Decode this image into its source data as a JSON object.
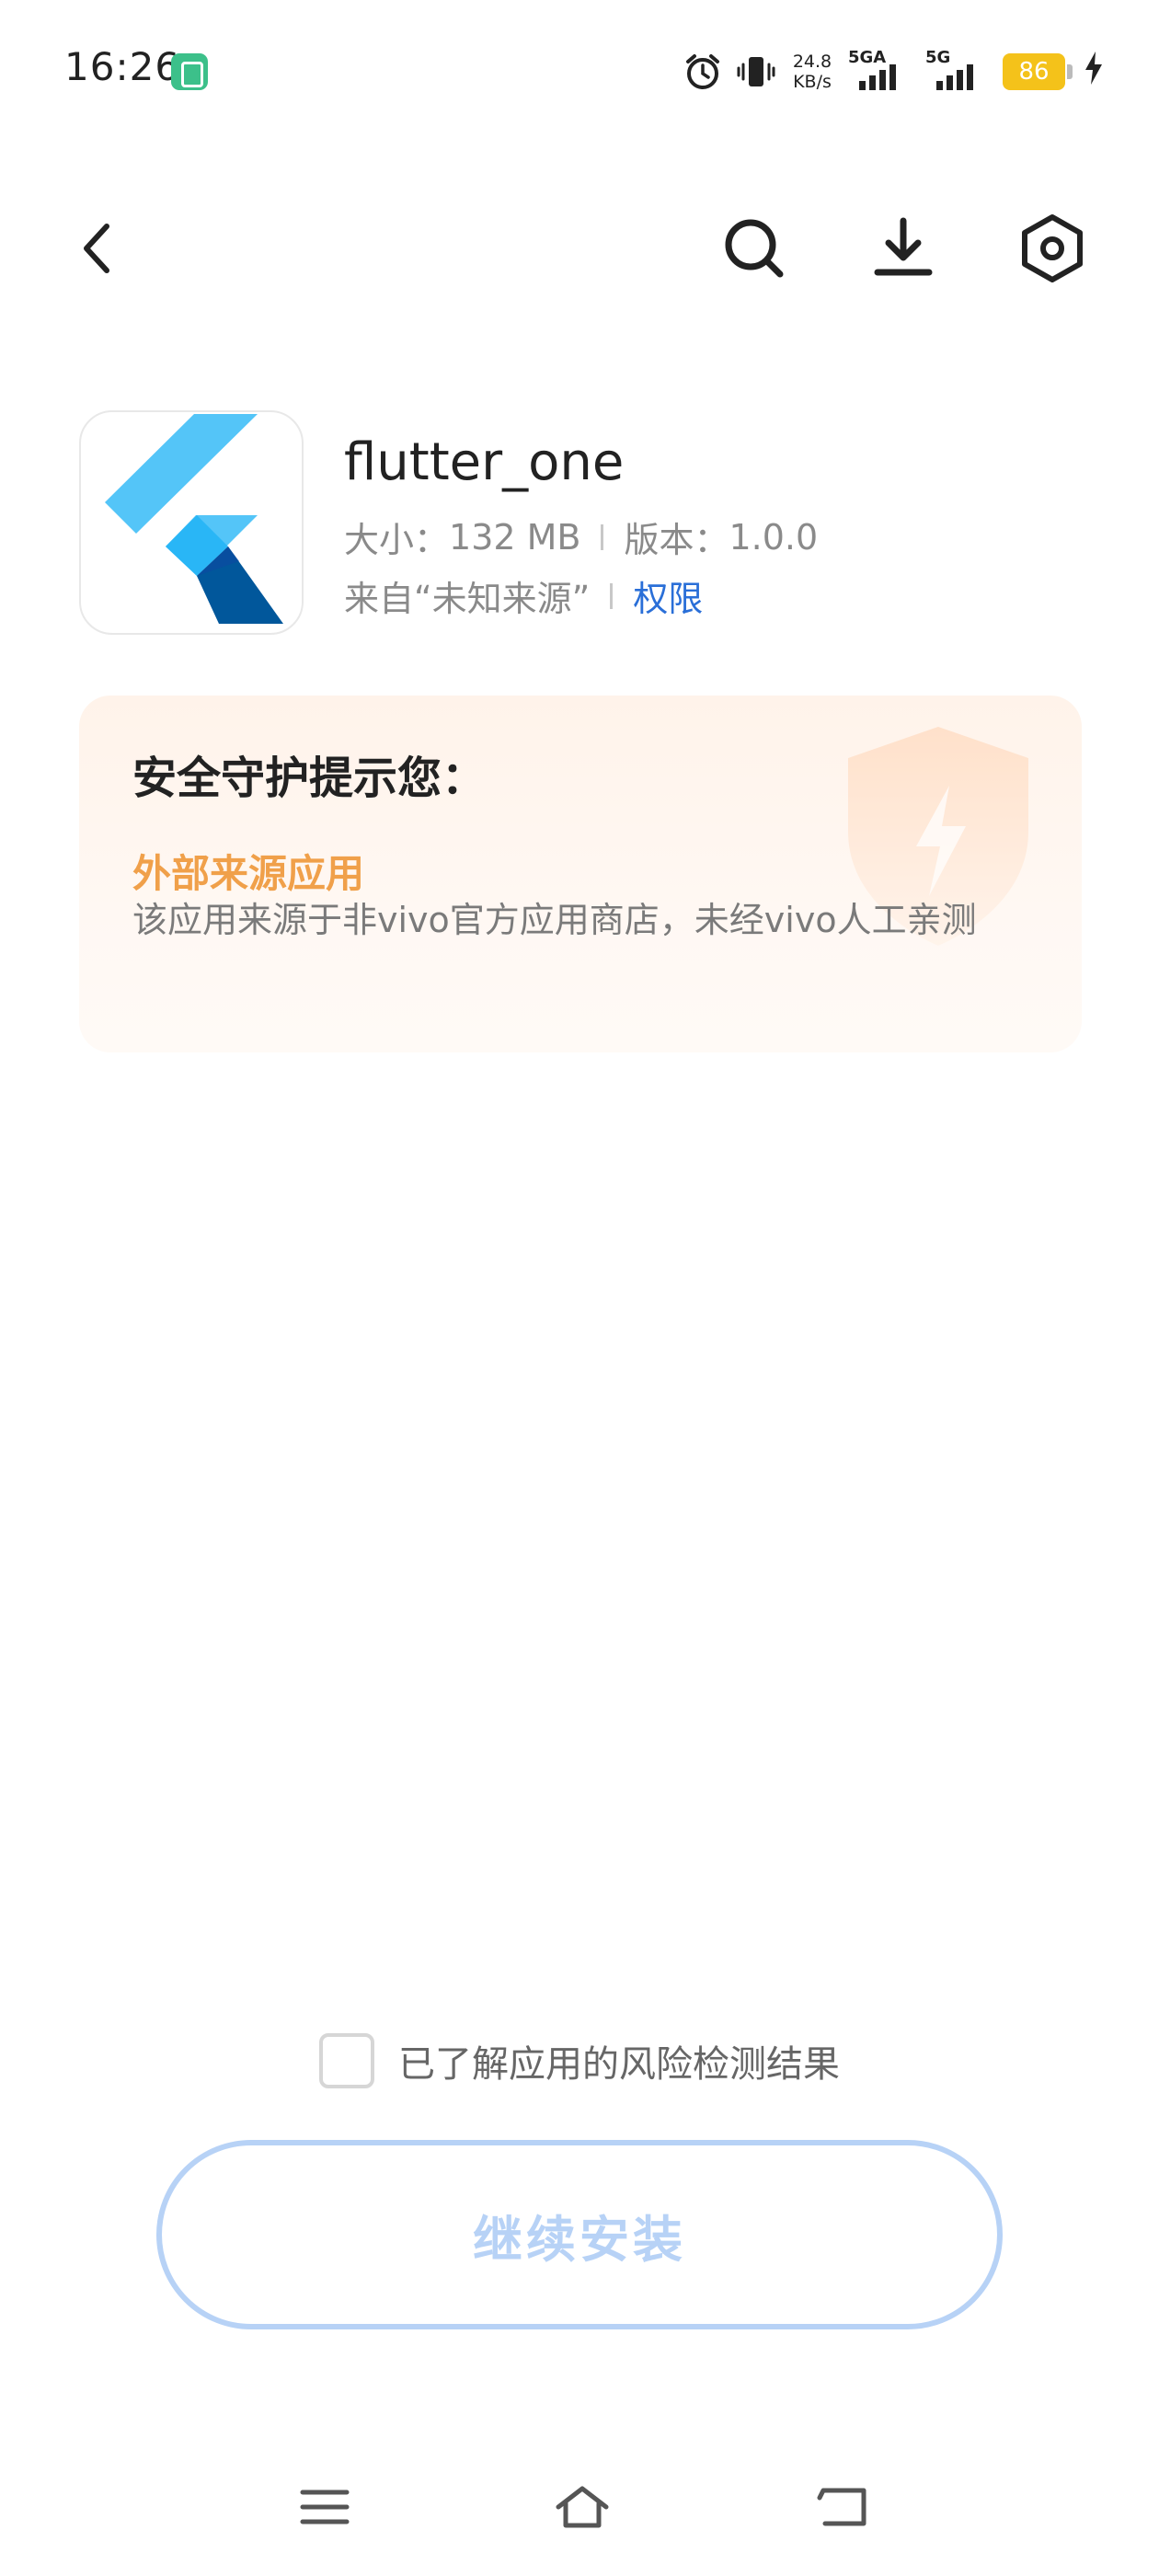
{
  "status_bar": {
    "time": "16:26",
    "net_speed_value": "24.8",
    "net_speed_unit": "KB/s",
    "sim1_label": "5GA",
    "sim2_label": "5G",
    "battery": "86"
  },
  "header": {
    "back_icon": "chevron-left-icon",
    "search_icon": "search-icon",
    "download_icon": "download-icon",
    "settings_icon": "hexagon-settings-icon"
  },
  "app": {
    "name": "flutter_one",
    "size_label": "大小：",
    "size_value": "132 MB",
    "version_label": "版本：",
    "version_value": "1.0.0",
    "source": "来自“未知来源”",
    "permission_link": "权限"
  },
  "security": {
    "title": "安全守护提示您：",
    "risk_title": "外部来源应用",
    "risk_desc": "该应用来源于非vivo官方应用商店，未经vivo人工亲测"
  },
  "footer": {
    "ack_label": "已了解应用的风险检测结果",
    "install_label": "继续安装"
  },
  "colors": {
    "accent_link": "#2a6fd8",
    "risk_orange": "#f0a04a",
    "button_disabled": "#b7d2f6",
    "card_bg": "#fff3ea"
  }
}
